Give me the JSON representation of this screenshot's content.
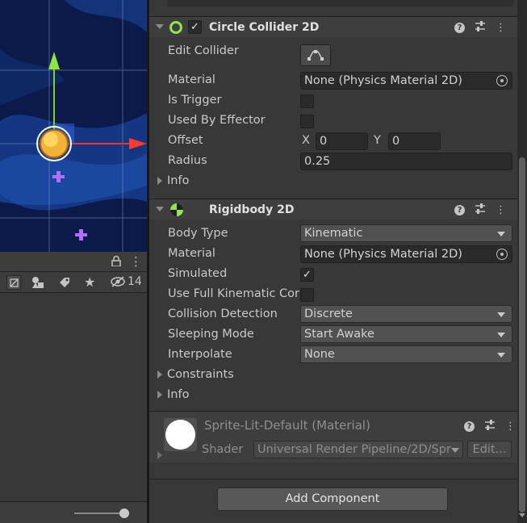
{
  "scene": {
    "name": "scene-view"
  },
  "left_panel": {
    "icons_badge": "14"
  },
  "circle_collider": {
    "title": "Circle Collider 2D",
    "enabled_check": "✓",
    "edit_collider_label": "Edit Collider",
    "material_label": "Material",
    "material_value": "None (Physics Material 2D)",
    "is_trigger_label": "Is Trigger",
    "used_by_effector_label": "Used By Effector",
    "offset_label": "Offset",
    "offset_x_label": "X",
    "offset_x_value": "0",
    "offset_y_label": "Y",
    "offset_y_value": "0",
    "radius_label": "Radius",
    "radius_value": "0.25",
    "info_label": "Info"
  },
  "rigidbody": {
    "title": "Rigidbody 2D",
    "body_type_label": "Body Type",
    "body_type_value": "Kinematic",
    "material_label": "Material",
    "material_value": "None (Physics Material 2D)",
    "simulated_label": "Simulated",
    "simulated_check": "✓",
    "use_full_kinematic_label": "Use Full Kinematic Cor",
    "collision_detection_label": "Collision Detection",
    "collision_detection_value": "Discrete",
    "sleeping_mode_label": "Sleeping Mode",
    "sleeping_mode_value": "Start Awake",
    "interpolate_label": "Interpolate",
    "interpolate_value": "None",
    "constraints_label": "Constraints",
    "info_label": "Info"
  },
  "material": {
    "title": "Sprite-Lit-Default (Material)",
    "shader_label": "Shader",
    "shader_value": "Universal Render Pipeline/2D/Spr",
    "edit_button": "Edit..."
  },
  "add_component_label": "Add Component",
  "header_icons": {
    "help": "?",
    "more": "⋮"
  }
}
